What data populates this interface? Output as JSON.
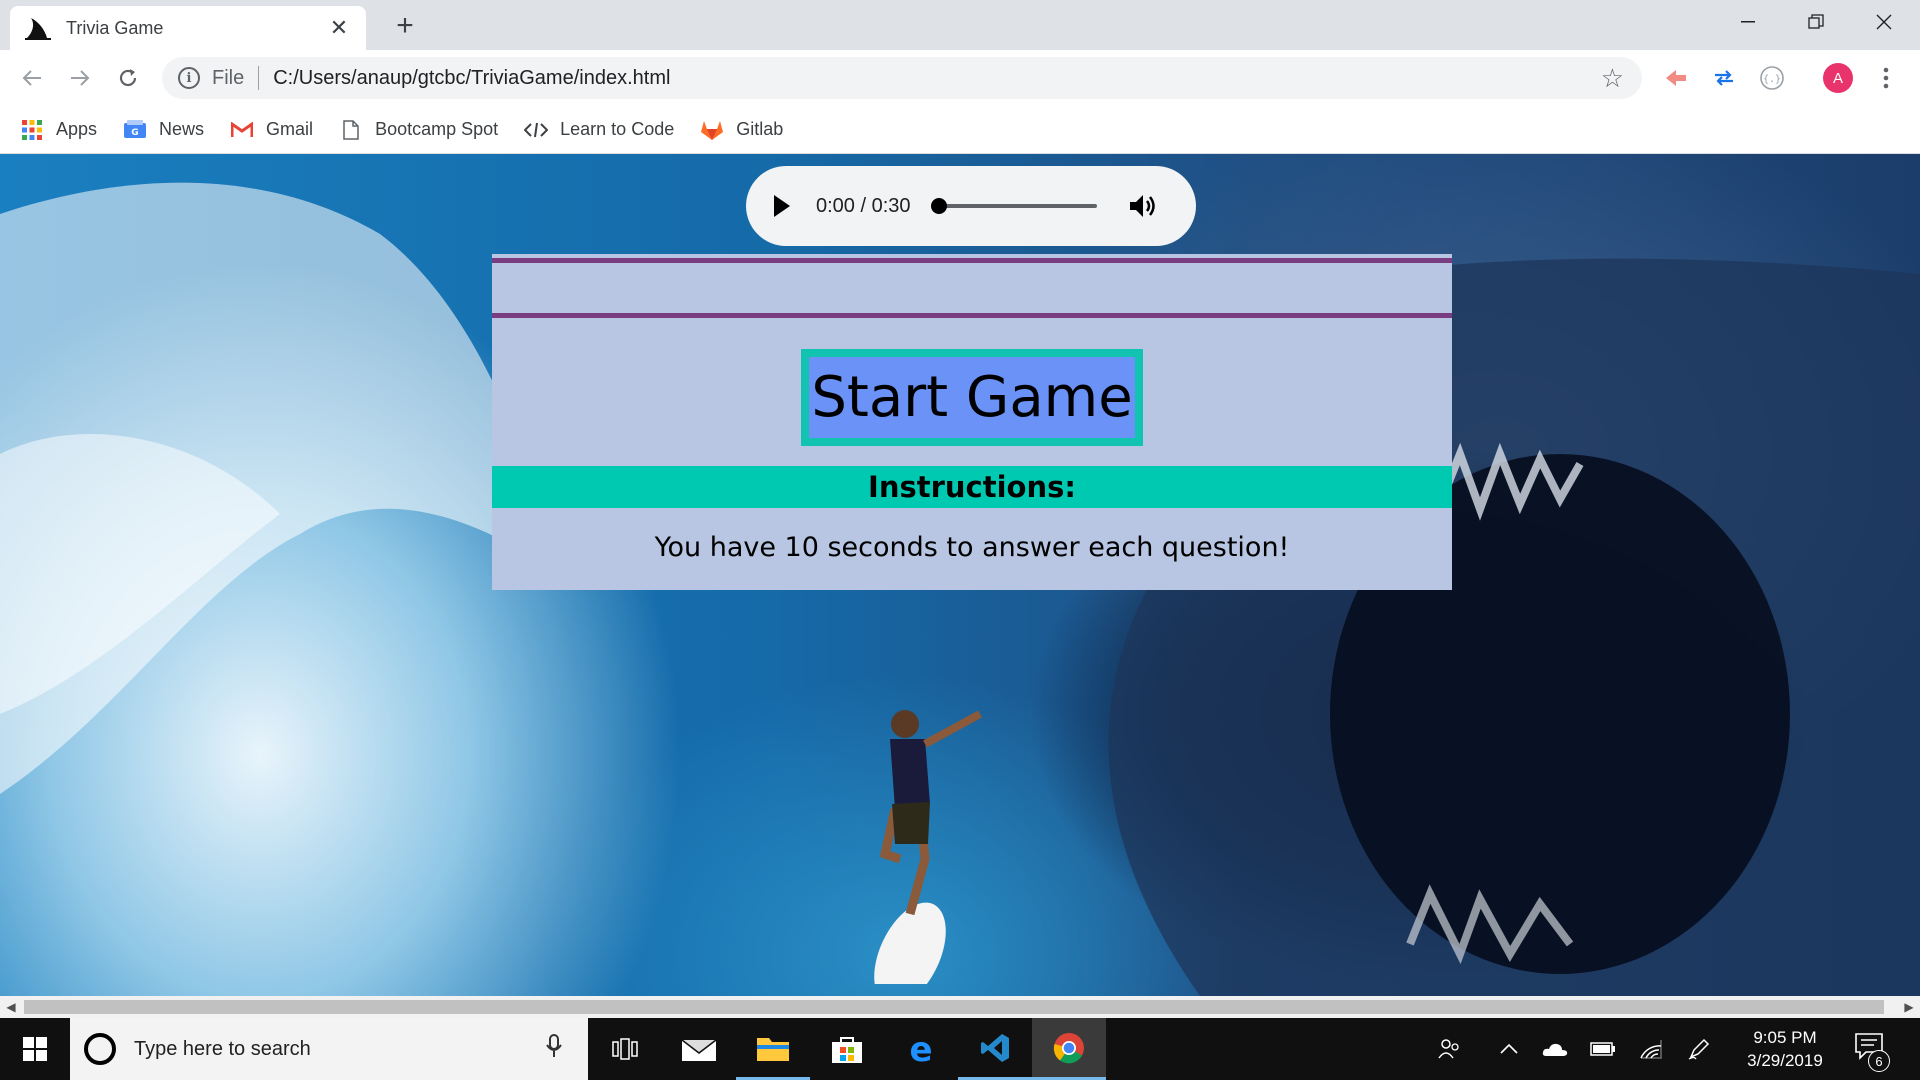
{
  "browser": {
    "tab": {
      "title": "Trivia Game",
      "favicon": "shark-fin-icon"
    },
    "new_tab": "+",
    "omnibox": {
      "scheme": "File",
      "url": "C:/Users/anaup/gtcbc/TriviaGame/index.html"
    },
    "profile_initial": "A"
  },
  "bookmarks": [
    {
      "label": "Apps",
      "icon": "apps-grid-icon"
    },
    {
      "label": "News",
      "icon": "news-icon"
    },
    {
      "label": "Gmail",
      "icon": "gmail-icon"
    },
    {
      "label": "Bootcamp Spot",
      "icon": "page-icon"
    },
    {
      "label": "Learn to Code",
      "icon": "code-icon"
    },
    {
      "label": "Gitlab",
      "icon": "gitlab-icon"
    }
  ],
  "page": {
    "audio": {
      "time": "0:00 / 0:30",
      "progress": 0
    },
    "start_button": "Start Game",
    "instructions_heading": "Instructions:",
    "instructions_text": "You have 10 seconds to answer each question!"
  },
  "taskbar": {
    "search_placeholder": "Type here to search",
    "time": "9:05 PM",
    "date": "3/29/2019",
    "notification_count": "6"
  },
  "colors": {
    "panel": "#b8c6e3",
    "panel_line": "#7b3d81",
    "start_button_bg": "#6a92f7",
    "start_button_border": "#12c3b2",
    "instructions_bar": "#00c9b1"
  }
}
